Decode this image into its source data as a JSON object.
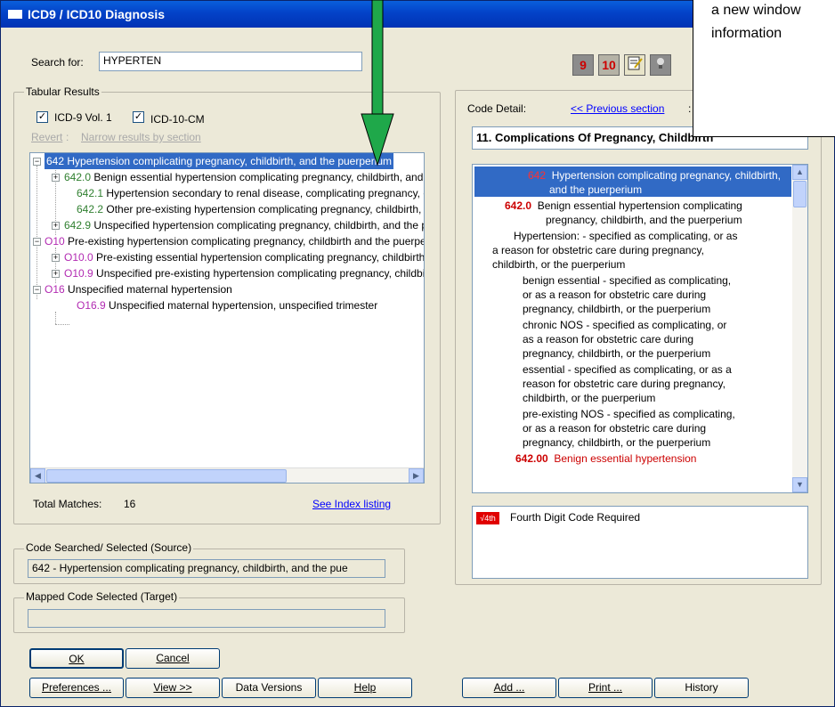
{
  "window": {
    "title": "ICD9 / ICD10 Diagnosis"
  },
  "search": {
    "label": "Search for:",
    "value": "HYPERTEN"
  },
  "toolbar": {
    "btn9": "9",
    "btn10": "10"
  },
  "tabular": {
    "group_label": "Tabular Results",
    "cb_icd9": "ICD-9 Vol. 1",
    "cb_icd10": "ICD-10-CM",
    "revert": "Revert",
    "sep": ":",
    "narrow": "Narrow results by section",
    "rows": [
      {
        "code": "642",
        "text": "Hypertension complicating pregnancy, childbirth, and the puerperium"
      },
      {
        "code": "642.0",
        "text": "Benign essential hypertension complicating pregnancy, childbirth, and the puerperium"
      },
      {
        "code": "642.1",
        "text": "Hypertension secondary to renal disease, complicating pregnancy, childbirth, and the puerperium"
      },
      {
        "code": "642.2",
        "text": "Other pre-existing hypertension complicating pregnancy, childbirth, and the puerperium"
      },
      {
        "code": "642.9",
        "text": "Unspecified hypertension complicating pregnancy, childbirth, and the puerperium"
      },
      {
        "code": "O10",
        "text": "Pre-existing hypertension complicating pregnancy, childbirth and the puerperium"
      },
      {
        "code": "O10.0",
        "text": "Pre-existing essential hypertension complicating pregnancy, childbirth and the puerperium"
      },
      {
        "code": "O10.9",
        "text": "Unspecified pre-existing hypertension complicating pregnancy, childbirth and the puerperium"
      },
      {
        "code": "O16",
        "text": "Unspecified maternal hypertension"
      },
      {
        "code": "O16.9",
        "text": "Unspecified maternal hypertension, unspecified trimester"
      }
    ],
    "total_label": "Total Matches:",
    "total_value": "16",
    "see_index": "See Index listing"
  },
  "code_detail": {
    "label": "Code Detail:",
    "prev_link": "<< Previous section",
    "colon": ":",
    "section": "11. Complications Of Pregnancy, Childbirth",
    "lines": [
      {
        "code": "642",
        "text": "Hypertension complicating pregnancy, childbirth,"
      },
      {
        "text": "and the puerperium"
      },
      {
        "code": "642.0",
        "text": "Benign essential hypertension complicating"
      },
      {
        "text": "pregnancy, childbirth, and the puerperium"
      },
      {
        "text": "Hypertension: - specified as complicating, or as"
      },
      {
        "text": "a reason for obstetric care during pregnancy,"
      },
      {
        "text": "childbirth, or the puerperium"
      },
      {
        "text": "benign essential - specified as complicating,"
      },
      {
        "text": "or as a reason for obstetric care during"
      },
      {
        "text": "pregnancy, childbirth, or the puerperium"
      },
      {
        "text": "chronic NOS - specified as complicating, or"
      },
      {
        "text": "as a reason for obstetric care during"
      },
      {
        "text": "pregnancy, childbirth, or the puerperium"
      },
      {
        "text": "essential - specified as complicating, or as a"
      },
      {
        "text": "reason for obstetric care during pregnancy,"
      },
      {
        "text": "childbirth, or the puerperium"
      },
      {
        "text": "pre-existing NOS - specified as complicating,"
      },
      {
        "text": "or as a reason for obstetric care during"
      },
      {
        "text": "pregnancy, childbirth, or the puerperium"
      },
      {
        "code": "642.00",
        "text": "Benign essential hypertension"
      }
    ],
    "note_badge": "√4th",
    "note_text": "Fourth Digit Code Required"
  },
  "source": {
    "label": "Code Searched/ Selected (Source)",
    "value": "642 - Hypertension complicating pregnancy, childbirth, and the pue"
  },
  "target": {
    "label": "Mapped Code Selected (Target)",
    "value": ""
  },
  "buttons": {
    "ok": "OK",
    "cancel": "Cancel",
    "preferences": "Preferences ...",
    "view": "View >>",
    "data_versions": "Data Versions",
    "help": "Help",
    "add": "Add ...",
    "print": "Print ...",
    "history": "History"
  },
  "callout": {
    "line1": "a new window",
    "line2": "information"
  },
  "colors": {
    "title_bar": "#0342c8",
    "selection": "#316ac5",
    "code_red": "#cc0000",
    "code_green": "#2f7f2f",
    "code_purple": "#b22ab2",
    "arrow": "#1fa84a"
  }
}
